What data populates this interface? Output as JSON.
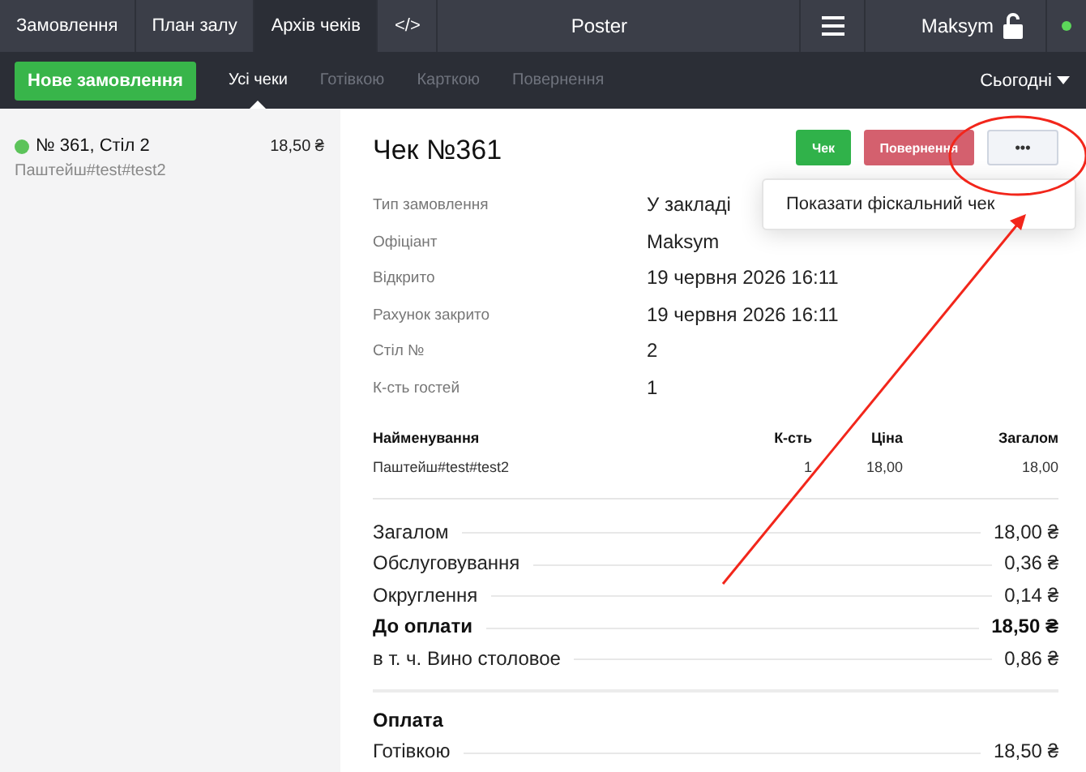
{
  "top_nav": {
    "tabs": [
      {
        "label": "Замовлення",
        "selected": false
      },
      {
        "label": "План залу",
        "selected": false
      },
      {
        "label": "Архів чеків",
        "selected": true
      },
      {
        "label": "</>",
        "selected": false
      }
    ],
    "title": "Poster",
    "user": "Maksym"
  },
  "filter_bar": {
    "new_order": "Нове замовлення",
    "filters": [
      {
        "label": "Усі чеки",
        "selected": true
      },
      {
        "label": "Готівкою",
        "selected": false
      },
      {
        "label": "Карткою",
        "selected": false
      },
      {
        "label": "Повернення",
        "selected": false
      }
    ],
    "period": "Сьогодні"
  },
  "receipts": [
    {
      "title": "№ 361, Стіл 2",
      "amount": "18,50 ₴",
      "subtitle": "Паштейш#test#test2",
      "color": "#5cc35a"
    }
  ],
  "receipt": {
    "title": "Чек №361",
    "buttons": [
      {
        "label": "Чек",
        "kind": "print"
      },
      {
        "label": "Повернення",
        "kind": "refund"
      },
      {
        "label": "•••",
        "kind": "more"
      }
    ],
    "menu": [
      "Показати фіскальний чек"
    ],
    "info": [
      {
        "label": "Тип замовлення",
        "value": "У закладі"
      },
      {
        "label": "Офіціант",
        "value": "Maksym"
      },
      {
        "label": "Відкрито",
        "value": "19 червня 2026 16:11"
      },
      {
        "label": "Рахунок закрито",
        "value": "19 червня 2026 16:11"
      },
      {
        "label": "Стіл №",
        "value": "2"
      },
      {
        "label": "К-сть гостей",
        "value": "1"
      }
    ],
    "columns": [
      "Найменування",
      "К-сть",
      "Ціна",
      "Загалом"
    ],
    "rows": [
      [
        "Паштейш#test#test2",
        "1",
        "18,00",
        "18,00"
      ]
    ],
    "totals": [
      {
        "label": "Загалом",
        "value": "18,00 ₴",
        "bold": false
      },
      {
        "label": "Обслуговування",
        "value": "0,36 ₴",
        "bold": false
      },
      {
        "label": "Округлення",
        "value": "0,14 ₴",
        "bold": false
      },
      {
        "label": "До оплати",
        "value": "18,50 ₴",
        "bold": true
      },
      {
        "label": "в т. ч. Вино столовое",
        "value": "0,86 ₴",
        "bold": false
      }
    ],
    "payment": {
      "heading": "Оплата",
      "rows": [
        {
          "label": "Готівкою",
          "value": "18,50 ₴"
        }
      ]
    }
  }
}
